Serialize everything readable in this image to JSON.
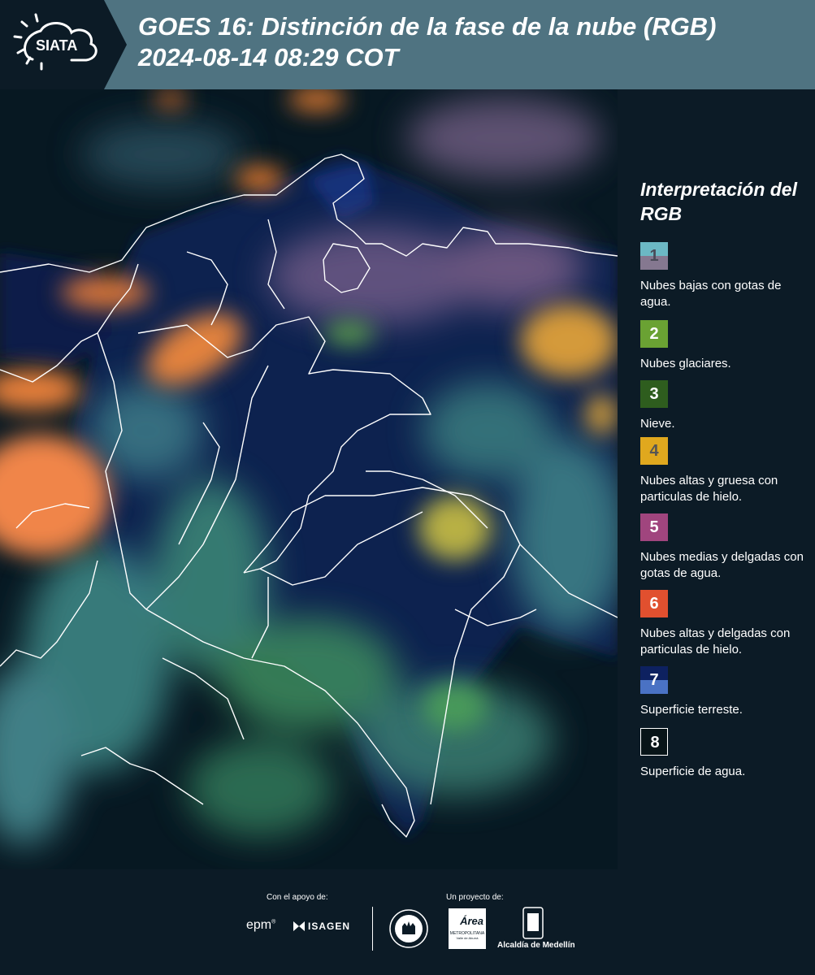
{
  "header": {
    "logo_text": "SIATA",
    "title_line1": "GOES 16: Distinción de la fase de la nube (RGB)",
    "title_line2": " 2024-08-14 08:29 COT"
  },
  "legend": {
    "title": "Interpretación del RGB",
    "items": [
      {
        "num": "1",
        "label": "Nubes bajas con gotas de agua.",
        "color_top": "#6cb8c4",
        "color_bottom": "#857890",
        "num_color": "#4a4a58"
      },
      {
        "num": "2",
        "label": "Nubes glaciares.",
        "color_top": "#6aa233",
        "color_bottom": "#6aa233",
        "num_color": "#ffffff"
      },
      {
        "num": "3",
        "label": "Nieve.",
        "color_top": "#2e5d1e",
        "color_bottom": "#2e5d1e",
        "num_color": "#ffffff"
      },
      {
        "num": "4",
        "label": "Nubes altas y gruesa con particulas de hielo.",
        "color_top": "#e0a81e",
        "color_bottom": "#e0a81e",
        "num_color": "#555555"
      },
      {
        "num": "5",
        "label": "Nubes medias y delgadas con gotas de agua.",
        "color_top": "#a0457e",
        "color_bottom": "#a0457e",
        "num_color": "#ffffff"
      },
      {
        "num": "6",
        "label": "Nubes altas y delgadas con particulas de hielo.",
        "color_top": "#e1502f",
        "color_bottom": "#e1502f",
        "num_color": "#ffffff"
      },
      {
        "num": "7",
        "label": "Superficie terreste.",
        "color_top": "#0d2160",
        "color_bottom": "#4a72c4",
        "num_color": "#ffffff"
      },
      {
        "num": "8",
        "label": "Superficie de agua.",
        "color_top": "#081418",
        "color_bottom": "#081418",
        "num_color": "#ffffff"
      }
    ]
  },
  "footer": {
    "support_label": "Con el apoyo de:",
    "project_label": "Un proyecto de:",
    "epm_logo": "epm",
    "isagen_logo": "ISAGEN",
    "area_logo_top": "Área",
    "area_logo_bottom": "METROPOLITANA",
    "area_logo_sub": "Valle de Aburrá",
    "alcaldia_label": "Alcaldía de Medellín"
  }
}
